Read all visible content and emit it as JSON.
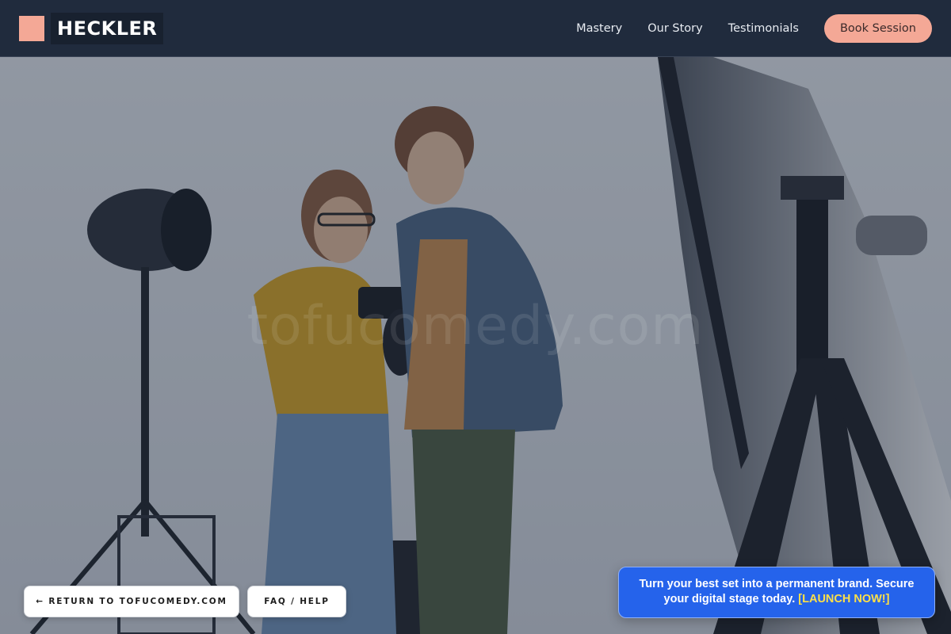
{
  "navbar": {
    "brand_name": "HECKLER",
    "links": [
      "Mastery",
      "Our Story",
      "Testimonials"
    ],
    "cta_label": "Book Session"
  },
  "hero": {
    "watermark": "tofucomedy.com"
  },
  "footer_buttons": {
    "return_label": "← RETURN TO TOFUCOMEDY.COM",
    "faq_label": "FAQ / HELP"
  },
  "promo": {
    "text": "Turn your best set into a permanent brand. Secure your digital stage today.",
    "cta": "[LAUNCH NOW!]"
  },
  "colors": {
    "navbar_bg": "#202b3d",
    "accent_salmon": "#f4a896",
    "promo_blue": "#2563eb",
    "promo_cta_yellow": "#fde047"
  }
}
